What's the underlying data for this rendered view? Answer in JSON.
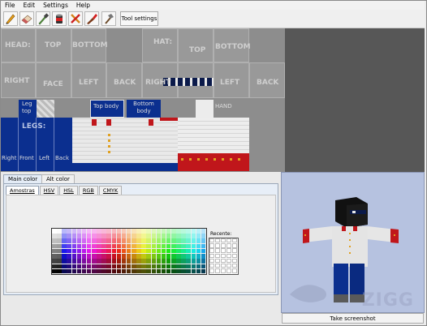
{
  "menu": {
    "items": [
      "File",
      "Edit",
      "Settings",
      "Help"
    ]
  },
  "toolbar": {
    "tool_settings_label": "Tool settings",
    "tools": [
      "pencil-icon",
      "eraser-icon",
      "eyedropper-icon",
      "bucket-icon",
      "crossed-tools-icon",
      "brush-icon",
      "hammer-icon"
    ]
  },
  "skin_labels": {
    "head": "HEAD:",
    "top": "TOP",
    "bottom": "BOTTOM",
    "hat": "HAT:",
    "hat_top": "TOP",
    "hat_bottom": "BOTTOM",
    "right": "RIGHT",
    "face": "FACE",
    "left": "LEFT",
    "back": "BACK",
    "right2": "RIGHT",
    "left2": "LEFT",
    "back2": "BACK",
    "leg_top": "Leg top",
    "top_body": "Top body",
    "bottom_body": "Bottom body",
    "hand": "HAND",
    "legs": "LEGS:",
    "leg_right": "Right",
    "leg_front": "Front",
    "leg_left": "Left",
    "leg_back": "Back"
  },
  "color_panel": {
    "tabs": [
      "Main color",
      "Alt color"
    ],
    "subtabs": [
      "Amostras",
      "HSV",
      "HSL",
      "RGB",
      "CMYK"
    ],
    "recent_label": "Recente:"
  },
  "preview": {
    "button_label": "Take screenshot",
    "watermark": "ZIGG"
  },
  "colors": {
    "accent": "#b6c2e0",
    "shirt_red": "#c0161b",
    "pants_blue": "#0a2f8a"
  }
}
